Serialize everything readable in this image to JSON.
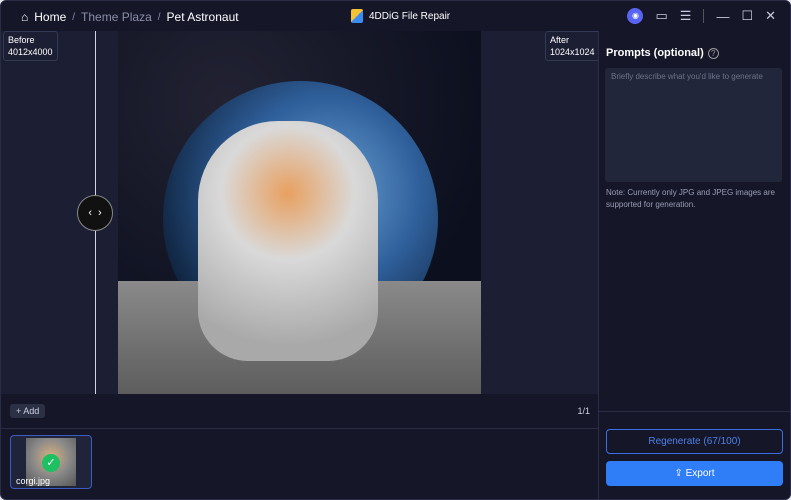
{
  "breadcrumb": {
    "home": "Home",
    "theme": "Theme Plaza",
    "current": "Pet Astronaut"
  },
  "app": {
    "title": "4DDiG File Repair"
  },
  "compare": {
    "before_label": "Before",
    "before_size": "4012x4000",
    "after_label": "After",
    "after_size": "1024x1024"
  },
  "bottom": {
    "add": "+ Add",
    "count": "1/1"
  },
  "thumbs": [
    {
      "name": "corgi.jpg"
    }
  ],
  "panel": {
    "title": "Prompts (optional)",
    "placeholder": "Briefly describe what you'd like to generate",
    "note": "Note: Currently only JPG and JPEG images are supported for generation.",
    "regenerate": "Regenerate (67/100)",
    "export": "Export"
  },
  "colors": {
    "accent": "#2f7ef8",
    "bg": "#151729"
  }
}
